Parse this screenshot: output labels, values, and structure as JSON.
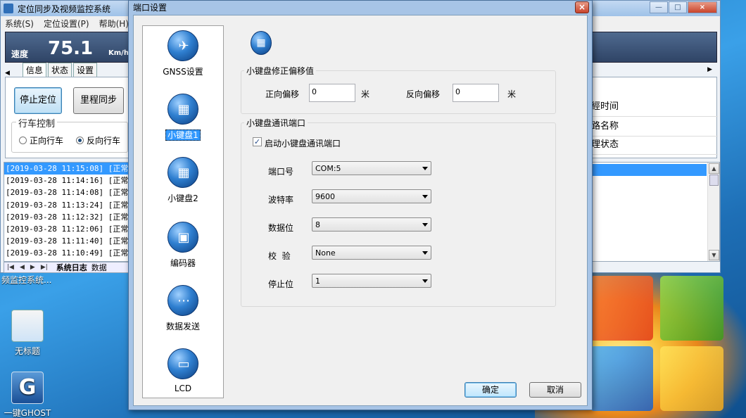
{
  "back_window": {
    "title": "定位同步及视频监控系统",
    "menu": [
      "系统(S)",
      "定位设置(P)",
      "帮助(H)"
    ],
    "speed": {
      "label": "速度",
      "value": "75.1",
      "unit": "Km/h"
    },
    "tabs": [
      "信息",
      "状态",
      "设置"
    ],
    "buttons": {
      "stop_locate": "停止定位",
      "mileage_sync": "里程同步"
    },
    "drive_control": {
      "title": "行车控制",
      "forward": "正向行车",
      "reverse": "反向行车",
      "selected": "reverse"
    },
    "log_rows": [
      "[2019-03-28 11:15:08] [正常]",
      "[2019-03-28 11:14:16] [正常]",
      "[2019-03-28 11:14:08] [正常]",
      "[2019-03-28 11:13:24] [正常]",
      "[2019-03-28 11:12:32] [正常]",
      "[2019-03-28 11:12:06] [正常]",
      "[2019-03-28 11:11:40] [正常]",
      "[2019-03-28 11:10:49] [正常]"
    ],
    "log_tabs": {
      "system_log": "系统日志",
      "other": "数据"
    },
    "right_labels": [
      "經时间",
      "路名称",
      "理状态"
    ],
    "taskbar_hint": "频监控系统..."
  },
  "desktop": {
    "icons": [
      {
        "label": "无标题"
      },
      {
        "label": "一键GHOST"
      }
    ]
  },
  "dialog": {
    "title": "端口设置",
    "close": "×",
    "nav_items": [
      {
        "label": "GNSS设置",
        "icon": "satellite-icon"
      },
      {
        "label": "小键盘1",
        "icon": "keypad-icon",
        "selected": true
      },
      {
        "label": "小键盘2",
        "icon": "keypad-icon"
      },
      {
        "label": "编码器",
        "icon": "encoder-icon"
      },
      {
        "label": "数据发送",
        "icon": "network-icon"
      },
      {
        "label": "LCD",
        "icon": "monitor-icon"
      }
    ],
    "offset_group": {
      "title": "小键盘修正偏移值",
      "forward_label": "正向偏移",
      "forward_value": "0",
      "reverse_label": "反向偏移",
      "reverse_value": "0",
      "unit": "米"
    },
    "port_group": {
      "title": "小键盘通讯端口",
      "enable_label": "启动小键盘通讯端口",
      "enabled": true,
      "fields": [
        {
          "label": "端口号",
          "value": "COM:5"
        },
        {
          "label": "波特率",
          "value": "9600"
        },
        {
          "label": "数据位",
          "value": "8"
        },
        {
          "label": "校  验",
          "value": "None"
        },
        {
          "label": "停止位",
          "value": "1"
        }
      ]
    },
    "ok": "确定",
    "cancel": "取消"
  }
}
